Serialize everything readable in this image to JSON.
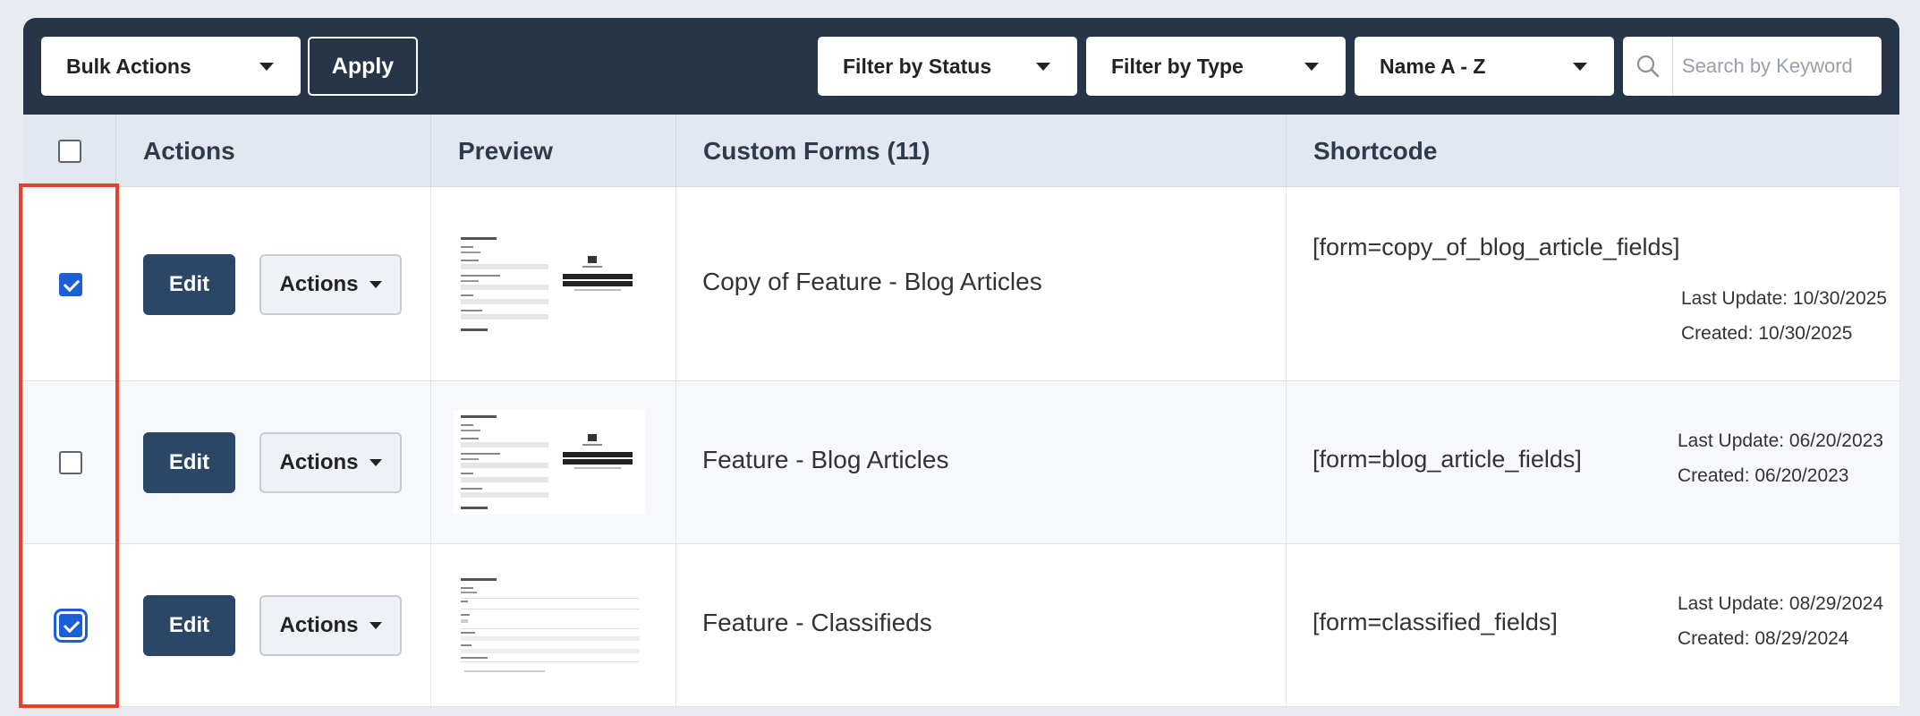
{
  "toolbar": {
    "bulk_actions": "Bulk Actions",
    "apply": "Apply",
    "filter_status": "Filter by Status",
    "filter_type": "Filter by Type",
    "sort": "Name A - Z",
    "search_placeholder": "Search by Keyword"
  },
  "table": {
    "headers": {
      "actions": "Actions",
      "preview": "Preview",
      "forms": "Custom Forms (11)",
      "shortcode": "Shortcode"
    },
    "rows": [
      {
        "checked": true,
        "edit": "Edit",
        "actions": "Actions",
        "name": "Copy of Feature - Blog Articles",
        "shortcode": "[form=copy_of_blog_article_fields]",
        "last_update": "Last Update: 10/30/2025",
        "created": "Created: 10/30/2025"
      },
      {
        "checked": false,
        "edit": "Edit",
        "actions": "Actions",
        "name": "Feature - Blog Articles",
        "shortcode": "[form=blog_article_fields]",
        "last_update": "Last Update: 06/20/2023",
        "created": "Created: 06/20/2023"
      },
      {
        "checked": true,
        "edit": "Edit",
        "actions": "Actions",
        "name": "Feature - Classifieds",
        "shortcode": "[form=classified_fields]",
        "last_update": "Last Update: 08/29/2024",
        "created": "Created: 08/29/2024"
      }
    ]
  },
  "colors": {
    "toolbar_bg": "#273549",
    "edit_button": "#2c4766",
    "checkbox_checked": "#1a5fd6",
    "highlight_box": "#e8402b"
  },
  "icons": {
    "search": "search-icon",
    "caret": "caret-down-icon"
  }
}
